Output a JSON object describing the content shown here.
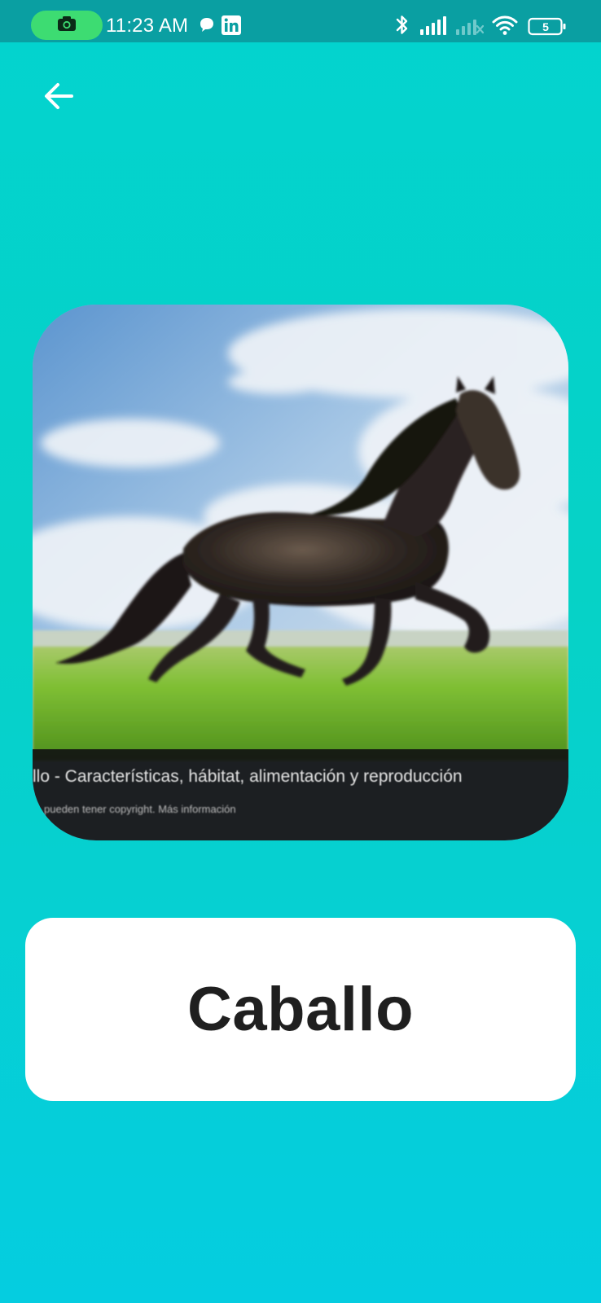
{
  "status_bar": {
    "time": "11:23 AM",
    "battery_level": "5",
    "icons": [
      "camera-icon",
      "chat-bubble-icon",
      "linkedin-icon",
      "bluetooth-icon",
      "signal-icon",
      "signal-off-icon",
      "wifi-icon",
      "battery-icon"
    ]
  },
  "nav": {
    "back_icon": "arrow-left-icon"
  },
  "image": {
    "caption_title": "llo - Características, hábitat, alimentación y reproducción",
    "caption_sub": "pueden tener copyright. Más información"
  },
  "label": {
    "text": "Caballo"
  },
  "colors": {
    "background_top": "#03d3cf",
    "background_bottom": "#05cde0",
    "status_bar": "#0a9fa2",
    "camera_pill": "#3ddc72",
    "card": "#ffffff",
    "label_text": "#1f1f1f"
  }
}
